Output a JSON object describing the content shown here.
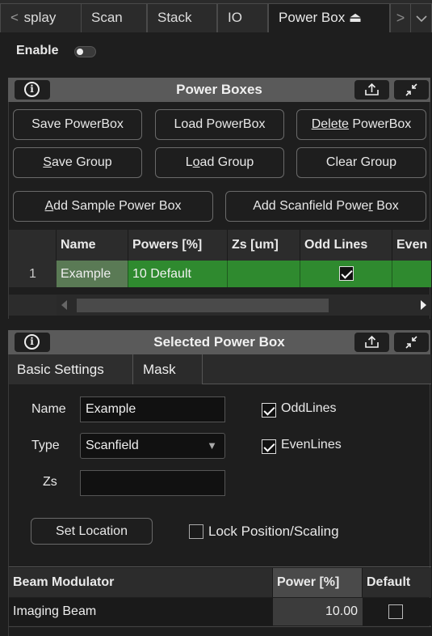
{
  "tabs": [
    {
      "label": "splay",
      "active": false
    },
    {
      "label": "Scan",
      "active": false
    },
    {
      "label": "Stack",
      "active": false
    },
    {
      "label": "IO",
      "active": false
    },
    {
      "label": "Power Box",
      "active": true
    }
  ],
  "eject_glyph": "⏏",
  "enable": {
    "label": "Enable",
    "on": false
  },
  "power_boxes": {
    "title": "Power Boxes",
    "buttons": {
      "save_powerbox": "Save PowerBox",
      "load_powerbox": "Load PowerBox",
      "delete_prefix": "Delete",
      "delete_suffix": " PowerBox",
      "save_group_u": "S",
      "save_group_rest": "ave Group",
      "load_group_pre": "L",
      "load_group_u": "o",
      "load_group_rest": "ad Group",
      "clear_group": "Clear Group",
      "add_sample_u": "A",
      "add_sample_rest": "dd Sample Power Box",
      "add_scanfield_pre": "Add Scanfield Powe",
      "add_scanfield_u": "r",
      "add_scanfield_rest": " Box"
    },
    "table": {
      "columns": [
        "Name",
        "Powers [%]",
        "Zs [um]",
        "Odd Lines",
        "Even"
      ],
      "rows": [
        {
          "index": "1",
          "name": "Example",
          "powers": "10  Default",
          "zs": "",
          "odd_lines": true
        }
      ]
    }
  },
  "selected_power_box": {
    "title": "Selected Power Box",
    "tabs": [
      "Basic Settings",
      "Mask"
    ],
    "name_label": "Name",
    "name_value": "Example",
    "type_label": "Type",
    "type_value": "Scanfield",
    "zs_label": "Zs",
    "zs_value": "",
    "odd_lines_label": "OddLines",
    "odd_lines": true,
    "even_lines_label": "EvenLines",
    "even_lines": true,
    "set_location": "Set Location",
    "lock_label": "Lock Position/Scaling",
    "lock": false,
    "beam_table": {
      "columns": [
        "Beam Modulator",
        "Power [%]",
        "Default"
      ],
      "rows": [
        {
          "name": "Imaging Beam",
          "power": "10.00",
          "default": false
        }
      ]
    }
  },
  "colors": {
    "selected_row": "#2f8a2f",
    "selected_name_cell": "#5a7a55",
    "panel_header": "#5a5a5a"
  }
}
